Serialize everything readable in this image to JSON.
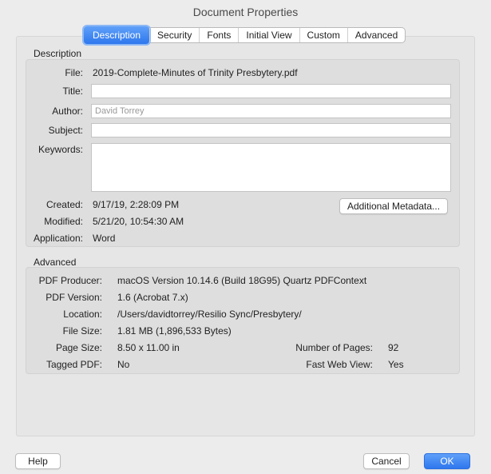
{
  "window": {
    "title": "Document Properties"
  },
  "tabs": [
    {
      "label": "Description"
    },
    {
      "label": "Security"
    },
    {
      "label": "Fonts"
    },
    {
      "label": "Initial View"
    },
    {
      "label": "Custom"
    },
    {
      "label": "Advanced"
    }
  ],
  "description": {
    "group_title": "Description",
    "file_label": "File:",
    "file_value": "2019-Complete-Minutes of Trinity Presbytery.pdf",
    "title_label": "Title:",
    "title_value": "",
    "author_label": "Author:",
    "author_value": "David Torrey",
    "subject_label": "Subject:",
    "subject_value": "",
    "keywords_label": "Keywords:",
    "keywords_value": "",
    "created_label": "Created:",
    "created_value": "9/17/19, 2:28:09 PM",
    "modified_label": "Modified:",
    "modified_value": "5/21/20, 10:54:30 AM",
    "application_label": "Application:",
    "application_value": "Word",
    "metadata_button": "Additional Metadata..."
  },
  "advanced": {
    "group_title": "Advanced",
    "producer_label": "PDF Producer:",
    "producer_value": "macOS Version 10.14.6 (Build 18G95) Quartz PDFContext",
    "version_label": "PDF Version:",
    "version_value": "1.6 (Acrobat 7.x)",
    "location_label": "Location:",
    "location_value": "/Users/davidtorrey/Resilio Sync/Presbytery/",
    "filesize_label": "File Size:",
    "filesize_value": "1.81 MB (1,896,533 Bytes)",
    "pagesize_label": "Page Size:",
    "pagesize_value": "8.50 x 11.00 in",
    "numpages_label": "Number of Pages:",
    "numpages_value": "92",
    "tagged_label": "Tagged PDF:",
    "tagged_value": "No",
    "fastweb_label": "Fast Web View:",
    "fastweb_value": "Yes"
  },
  "footer": {
    "help_button": "Help",
    "cancel_button": "Cancel",
    "ok_button": "OK"
  },
  "colors": {
    "accent": "#2e77ee",
    "panel": "#dedede",
    "window": "#ececec"
  }
}
